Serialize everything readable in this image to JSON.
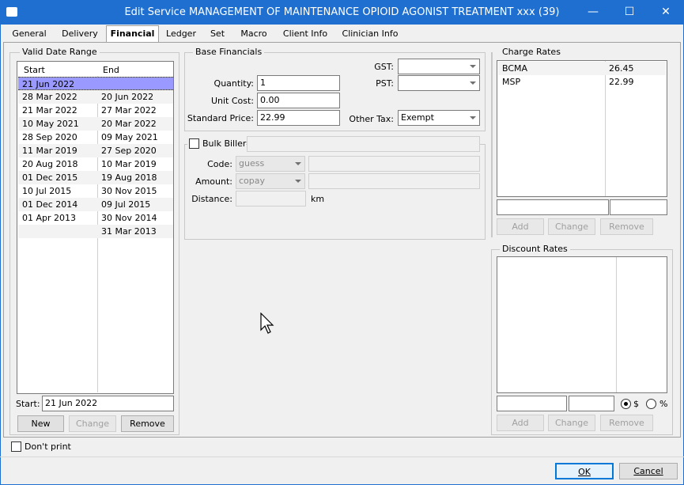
{
  "window": {
    "title": "Edit Service MANAGEMENT OF MAINTENANCE OPIOID AGONIST TREATMENT xxx (39)",
    "minimize": "—",
    "maximize": "☐",
    "close": "✕"
  },
  "tabs": [
    {
      "label": "General"
    },
    {
      "label": "Delivery"
    },
    {
      "label": "Financial"
    },
    {
      "label": "Ledger"
    },
    {
      "label": "Set"
    },
    {
      "label": "Macro"
    },
    {
      "label": "Client Info"
    },
    {
      "label": "Clinician Info"
    }
  ],
  "valid_date_range": {
    "legend": "Valid Date Range",
    "col_start": "Start",
    "col_end": "End",
    "rows": [
      {
        "start": "21 Jun 2022",
        "end": ""
      },
      {
        "start": "28 Mar 2022",
        "end": "20 Jun 2022"
      },
      {
        "start": "21 Mar 2022",
        "end": "27 Mar 2022"
      },
      {
        "start": "10 May 2021",
        "end": "20 Mar 2022"
      },
      {
        "start": "28 Sep 2020",
        "end": "09 May 2021"
      },
      {
        "start": "11 Mar 2019",
        "end": "27 Sep 2020"
      },
      {
        "start": "20 Aug 2018",
        "end": "10 Mar 2019"
      },
      {
        "start": "01 Dec 2015",
        "end": "19 Aug 2018"
      },
      {
        "start": "10 Jul 2015",
        "end": "30 Nov 2015"
      },
      {
        "start": "01 Dec 2014",
        "end": "09 Jul 2015"
      },
      {
        "start": "01 Apr 2013",
        "end": "30 Nov 2014"
      },
      {
        "start": "",
        "end": "31 Mar 2013"
      }
    ],
    "start_label": "Start:",
    "start_value": "21 Jun 2022",
    "new_label": "New",
    "change_label": "Change",
    "remove_label": "Remove"
  },
  "base_financials": {
    "legend": "Base Financials",
    "quantity_label": "Quantity:",
    "quantity_value": "1",
    "unit_cost_label": "Unit Cost:",
    "unit_cost_value": "0.00",
    "standard_price_label": "Standard Price:",
    "standard_price_value": "22.99",
    "gst_label": "GST:",
    "gst_value": "",
    "pst_label": "PST:",
    "pst_value": "",
    "other_tax_label": "Other Tax:",
    "other_tax_value": "Exempt"
  },
  "bulk_biller": {
    "label": "Bulk Biller:",
    "code_label": "Code:",
    "code_value": "guess",
    "amount_label": "Amount:",
    "amount_value": "copay",
    "distance_label": "Distance:",
    "distance_unit": "km"
  },
  "charge_rates": {
    "legend": "Charge Rates",
    "rows": [
      {
        "name": "BCMA",
        "value": "26.45"
      },
      {
        "name": "MSP",
        "value": "22.99"
      }
    ],
    "add_label": "Add",
    "change_label": "Change",
    "remove_label": "Remove"
  },
  "discount_rates": {
    "legend": "Discount Rates",
    "dollar_label": "$",
    "percent_label": "%",
    "add_label": "Add",
    "change_label": "Change",
    "remove_label": "Remove"
  },
  "dont_print_label": "Don't print",
  "ok_label": "OK",
  "cancel_label": "Cancel"
}
